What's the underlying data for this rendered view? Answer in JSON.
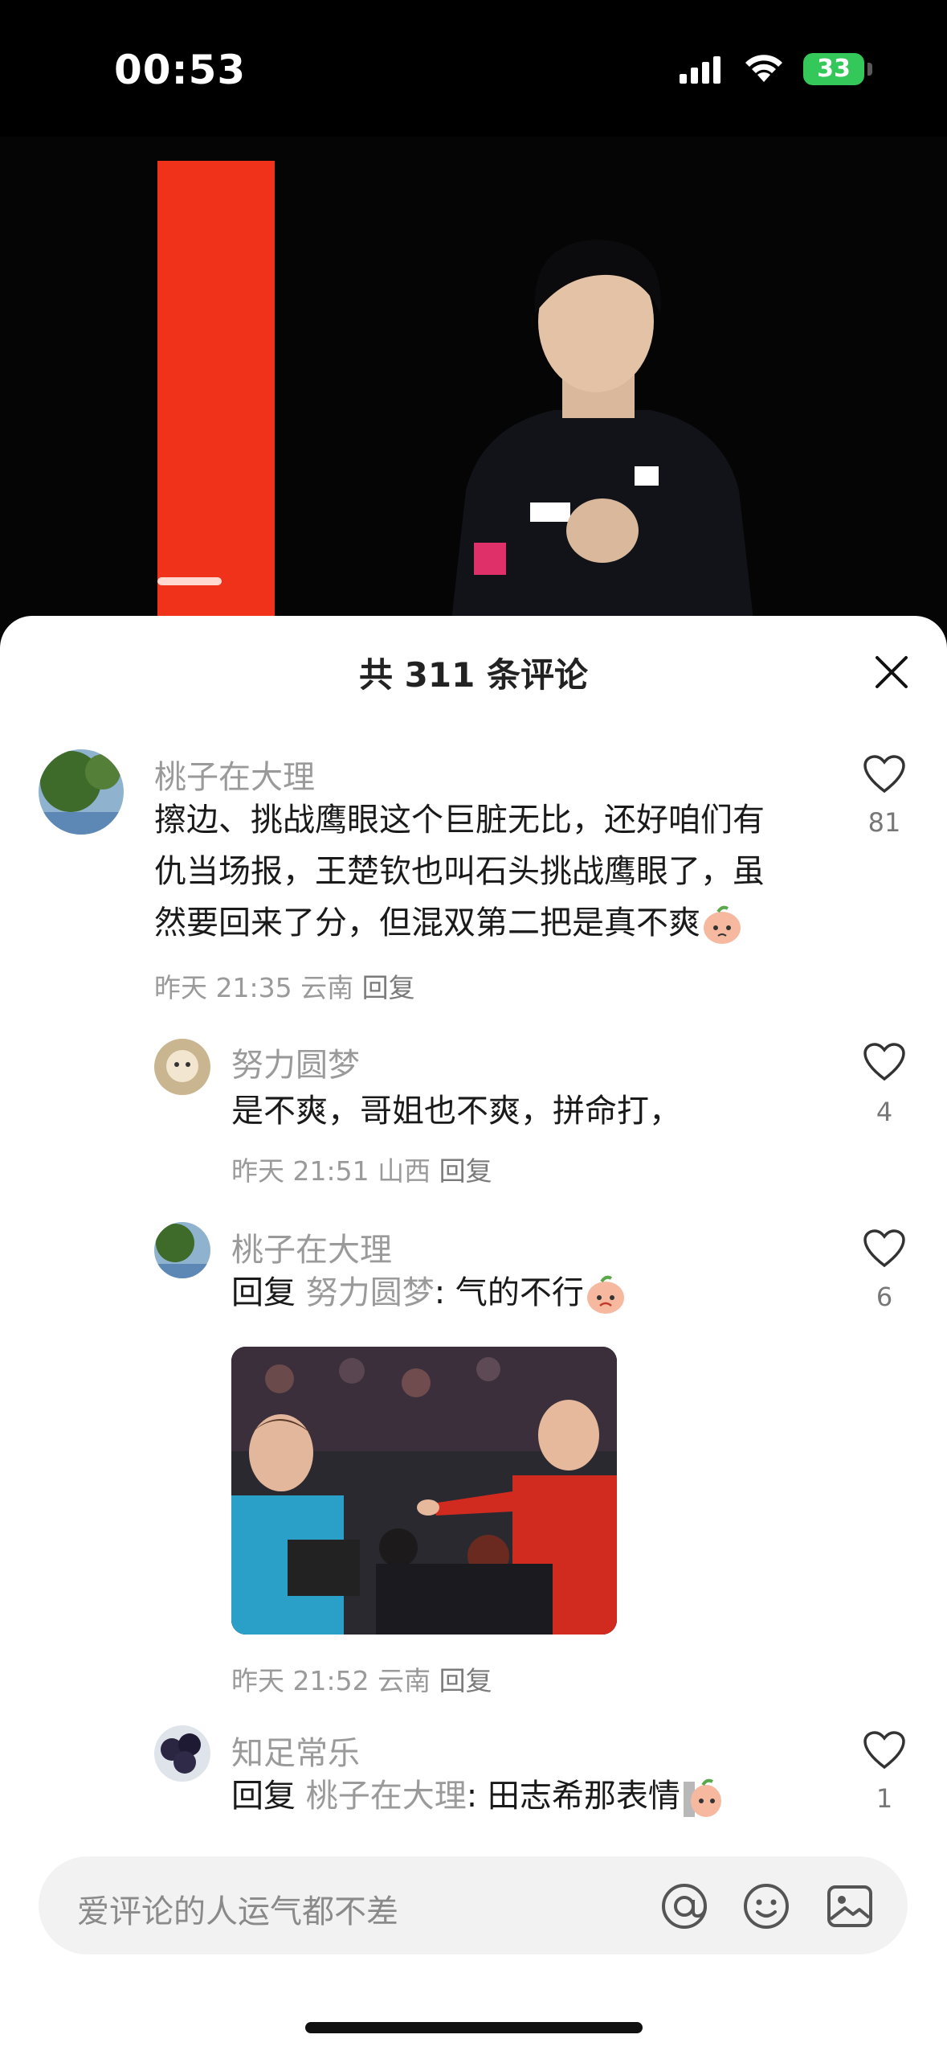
{
  "status_bar": {
    "time": "00:53",
    "battery": "33"
  },
  "sheet": {
    "title": "共 311 条评论"
  },
  "comments": [
    {
      "user": "桃子在大理",
      "text_lines": [
        "擦边、挑战鹰眼这个巨脏无比，还好咱们有",
        "仇当场报，王楚钦也叫石头挑战鹰眼了，虽",
        "然要回来了分，但混双第二把是真不爽"
      ],
      "time": "昨天 21:35",
      "location": "云南",
      "reply_label": "回复",
      "likes": "81"
    }
  ],
  "replies": [
    {
      "user": "努力圆梦",
      "text": "是不爽，哥姐也不爽，拼命打，",
      "time": "昨天 21:51",
      "location": "山西",
      "reply_label": "回复",
      "likes": "4"
    },
    {
      "user": "桃子在大理",
      "reply_prefix": "回复",
      "reply_to": "努力圆梦",
      "text": ": 气的不行",
      "time": "昨天 21:52",
      "location": "云南",
      "reply_label": "回复",
      "likes": "6"
    },
    {
      "user": "知足常乐",
      "reply_prefix": "回复",
      "reply_to": "桃子在大理",
      "text": ": 田志希那表情",
      "likes": "1"
    }
  ],
  "input": {
    "placeholder": "爱评论的人运气都不差",
    "icons": [
      "at-icon",
      "emoji-icon",
      "image-icon"
    ]
  },
  "colors": {
    "accent_red": "#f0321a",
    "battery_green": "#34c759",
    "grey_text": "#9a9a9a"
  }
}
